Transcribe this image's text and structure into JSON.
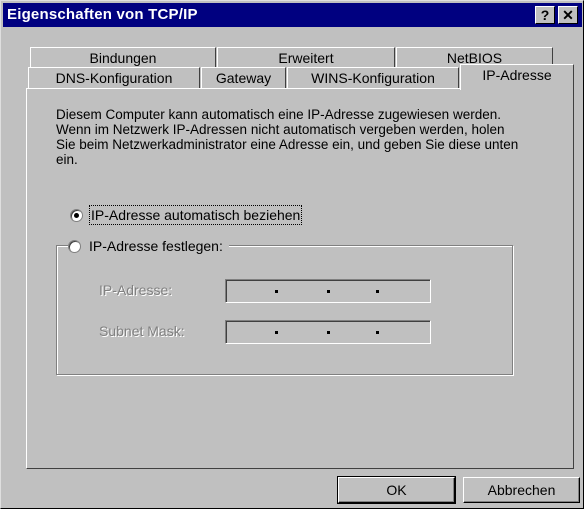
{
  "window": {
    "title": "Eigenschaften von TCP/IP",
    "help_label": "?",
    "close_label": "✕"
  },
  "tabs_row1": [
    {
      "label": "Bindungen"
    },
    {
      "label": "Erweitert"
    },
    {
      "label": "NetBIOS"
    }
  ],
  "tabs_row2": [
    {
      "label": "DNS-Konfiguration"
    },
    {
      "label": "Gateway"
    },
    {
      "label": "WINS-Konfiguration"
    },
    {
      "label": "IP-Adresse"
    }
  ],
  "panel": {
    "description": "Diesem Computer kann automatisch eine IP-Adresse zugewiesen werden. Wenn im Netzwerk IP-Adressen nicht automatisch vergeben werden, holen Sie beim Netzwerkadministrator eine Adresse ein, und geben Sie diese unten ein.",
    "radio_auto": {
      "label": "IP-Adresse automatisch beziehen",
      "checked": true
    },
    "radio_manual": {
      "label": "IP-Adresse festlegen:",
      "checked": false
    },
    "ip_label": "IP-Adresse:",
    "subnet_label": "Subnet Mask:"
  },
  "buttons": {
    "ok": "OK",
    "cancel": "Abbrechen"
  }
}
